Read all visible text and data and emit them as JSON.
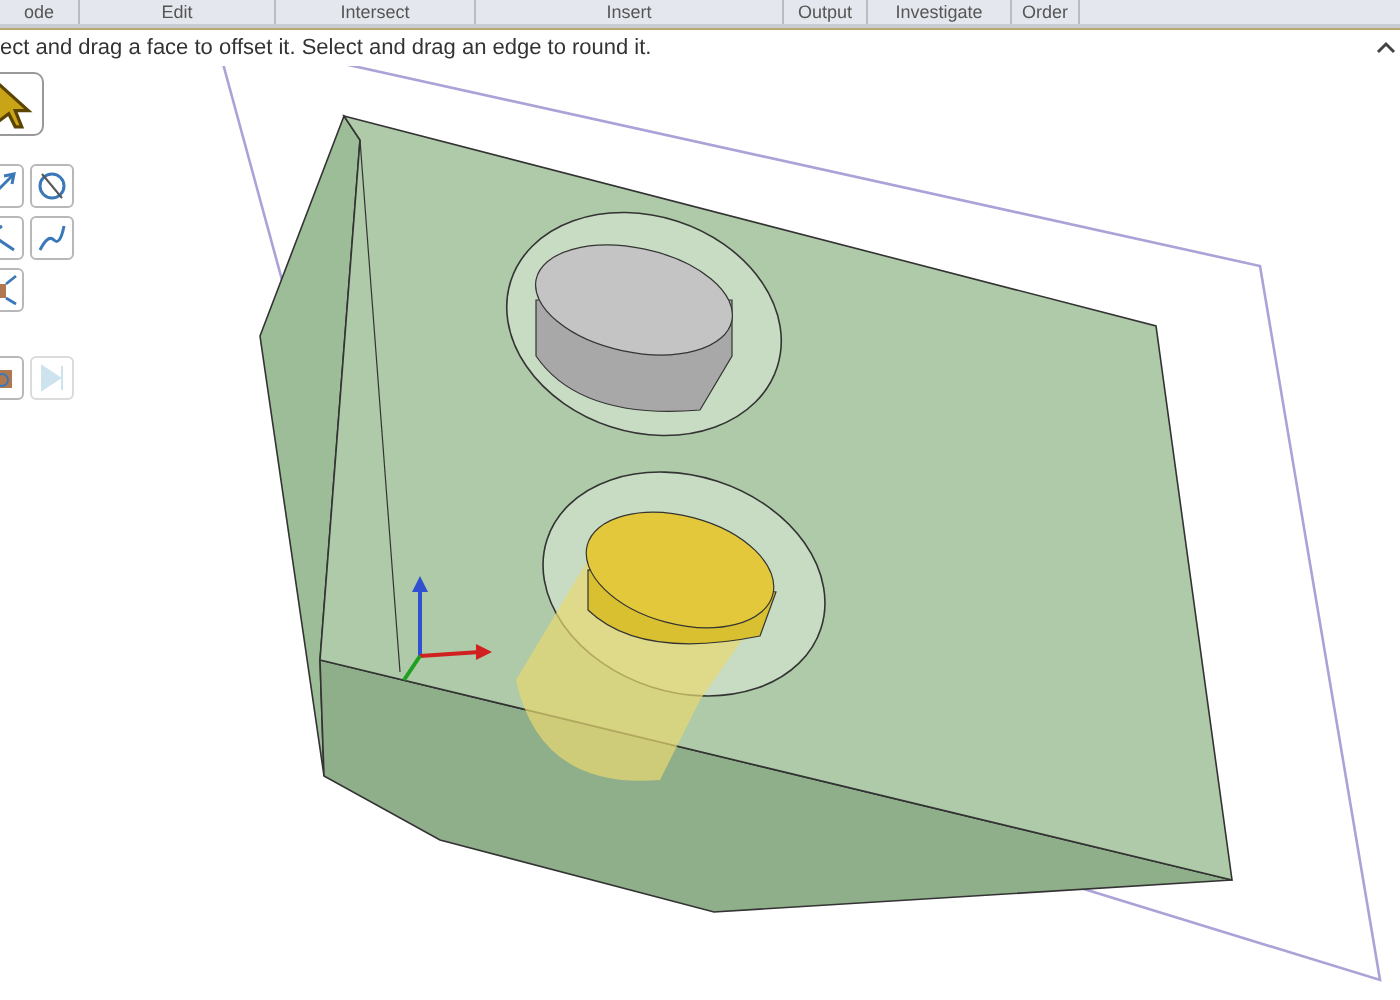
{
  "ribbon_groups": [
    {
      "label": "ode"
    },
    {
      "label": "Edit"
    },
    {
      "label": "Intersect"
    },
    {
      "label": "Insert"
    },
    {
      "label": "Output"
    },
    {
      "label": "Investigate"
    },
    {
      "label": "Order"
    }
  ],
  "hint": "ect and drag a face to offset it. Select and drag an edge to round it.",
  "tools": [
    {
      "kind": "select",
      "disabled": false
    },
    {
      "kind": "line",
      "disabled": false
    },
    {
      "kind": "pull-axis",
      "disabled": false
    },
    {
      "kind": "direction",
      "disabled": false
    },
    {
      "kind": "curve",
      "disabled": false
    },
    {
      "kind": "scale",
      "disabled": false
    },
    {
      "kind": "box",
      "disabled": false
    },
    {
      "kind": "skip",
      "disabled": true
    }
  ]
}
